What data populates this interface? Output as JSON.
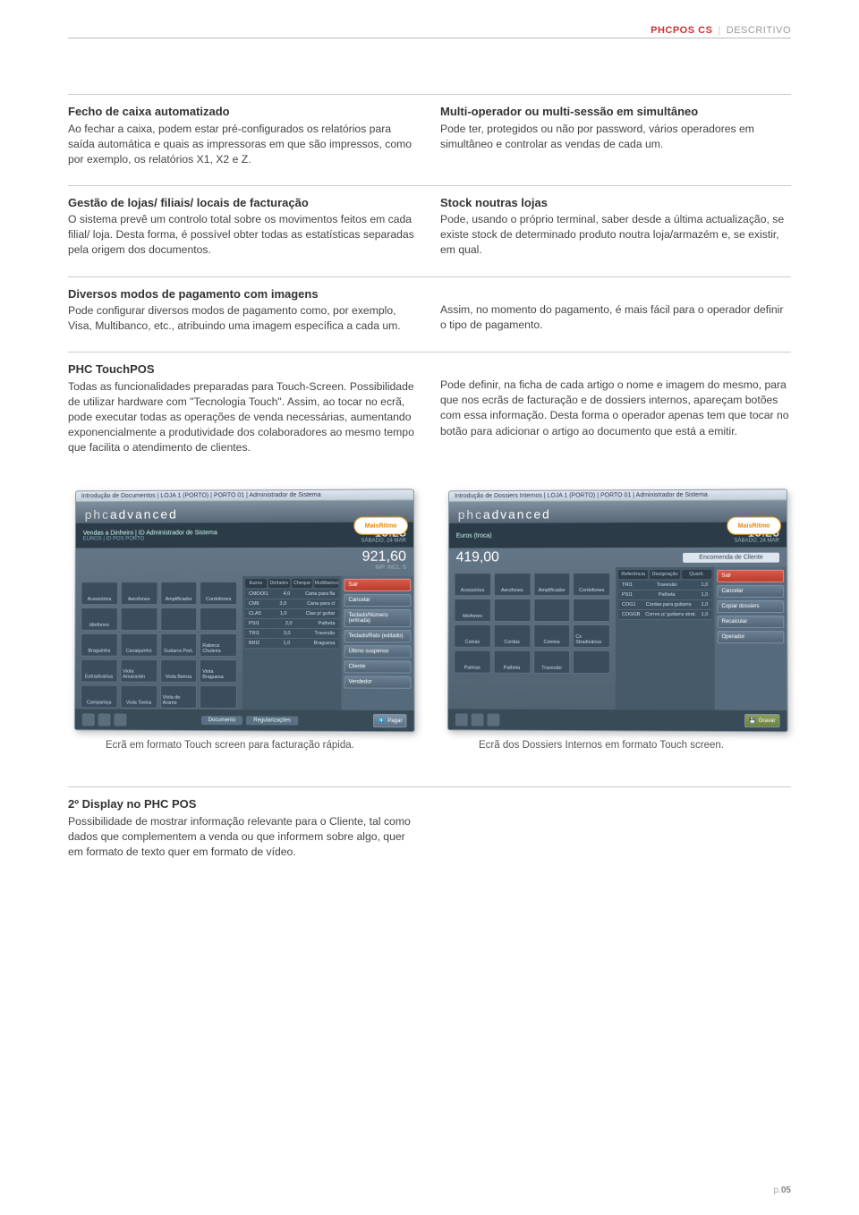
{
  "header": {
    "product": "PHCPOS CS",
    "section": "DESCRITIVO"
  },
  "blocks": [
    {
      "left": {
        "title": "Fecho de caixa automatizado",
        "body": "Ao fechar a caixa, podem estar pré-configurados os relatórios para saída automática e quais as impressoras em que são impressos, como por exemplo, os relatórios X1, X2 e Z."
      },
      "right": {
        "title": "Multi-operador ou multi-sessão em simultâneo",
        "body": "Pode ter, protegidos ou não por password, vários operadores em simultâneo e controlar as vendas de cada um."
      }
    },
    {
      "left": {
        "title": "Gestão de lojas/ filiais/ locais de facturação",
        "body": "O sistema prevê um controlo total sobre os movimentos feitos em cada filial/ loja. Desta forma, é possível obter todas as estatísticas separadas pela origem dos documentos."
      },
      "right": {
        "title": "Stock noutras lojas",
        "body": "Pode, usando o próprio terminal, saber desde a última actualização, se existe stock de determinado produto noutra loja/armazém e, se existir, em qual."
      }
    },
    {
      "left": {
        "title": "Diversos modos de pagamento com imagens",
        "body": "Pode configurar diversos modos de pagamento como, por exemplo, Visa, Multibanco, etc., atribuindo uma imagem específica a cada um."
      },
      "right": {
        "title": "",
        "body": "Assim, no momento do pagamento, é mais fácil para o operador definir o tipo de pagamento."
      }
    },
    {
      "left": {
        "title": "PHC TouchPOS",
        "body": "Todas as funcionalidades preparadas para Touch-Screen. Possibilidade de utilizar hardware com \"Tecnologia Touch\". Assim, ao tocar no ecrã, pode executar todas as operações de venda necessárias, aumentando exponencialmente a produtividade dos colaboradores ao mesmo tempo que facilita o atendimento de clientes."
      },
      "right": {
        "title": "",
        "body": "Pode definir, na ficha de cada artigo o nome e imagem do mesmo, para que nos ecrãs de facturação e de dossiers internos, apareçam botões com essa informação. Desta forma o operador apenas tem que tocar no botão para adicionar o artigo ao documento que está a emitir."
      }
    }
  ],
  "screenshots": {
    "left": {
      "titlebar": "Introdução de Documentos | LOJA 1 (PORTO) | PORTO 01 | Administrador de Sistema",
      "logo": "phcadvanced",
      "barTitle": "Vendas a Dinheiro | ID Administrador de Sistema",
      "barSub": "EUROS | ID POS PORTO",
      "time": "19:23",
      "day": "SÁBADO, 24 MAR",
      "total": "921,60",
      "totalSub": "IMP. INCL. S",
      "tabs": [
        "Euros",
        "Dinheiro",
        "Cheque",
        "Multibanco"
      ],
      "list": [
        [
          "CMOOI1",
          "4,0",
          "Cana para fla"
        ],
        [
          "CM6",
          "3,0",
          "Cana para cl"
        ],
        [
          "CLA5",
          "1,0",
          "Clas p/ guitar"
        ],
        [
          "PSI1",
          "2,0",
          "Palheta"
        ],
        [
          "TRI1",
          "3,0",
          "Travesão"
        ],
        [
          "BRI2",
          "1,0",
          "Braguesa"
        ]
      ],
      "gridItems": [
        "Acessórios",
        "Aerofones",
        "Amplificador",
        "Cordofones",
        "Idiofones",
        "",
        "",
        "",
        "Braguinha",
        "Cavaquinho",
        "Guitarra Port.",
        "Rabeca Chuleira",
        "Estradivárius",
        "Viola Amarantin",
        "Viola Beiroa",
        "Viola Braguesa",
        "Campaniça",
        "Viola Toeira",
        "Viola de Arame",
        ""
      ],
      "rightButtons": [
        "Sair",
        "Cancelar",
        "Teclado/Número (entrada)",
        "Teclado/Rato (editado)",
        "Último suspenso",
        "Cliente",
        "Vendedor"
      ],
      "footTabs": [
        "Documento",
        "Regularizações"
      ],
      "pagar": "Pagar",
      "mais": "MaisRitmo",
      "caption": "Ecrã em formato Touch screen para facturação rápida."
    },
    "right": {
      "titlebar": "Introdução de Dossiers Internos | LOJA 1 (PORTO) | PORTO 01 | Administrador de Sistema",
      "logo": "phcadvanced",
      "barTitle": "Euros (troca)",
      "time": "19:26",
      "day": "SÁBADO, 24 MAR",
      "total": "419,00",
      "encomenda": "Encomenda de Cliente",
      "tabs": [
        "Referência",
        "Designação",
        "Quant."
      ],
      "list": [
        [
          "TRI1",
          "Travesão",
          "1,0"
        ],
        [
          "PSI1",
          "Palheta",
          "1,0"
        ],
        [
          "COG1",
          "Cordas para guitarra",
          "1,0"
        ],
        [
          "COGGB",
          "Corres p/ guitarra strat.",
          "1,0"
        ]
      ],
      "gridItems": [
        "Acessórios",
        "Aerofones",
        "Amplificador",
        "Cordofones",
        "Idiofones",
        "",
        "",
        "",
        "Caixas",
        "Cordas",
        "Correia",
        "Cx Stradivárius",
        "Palmas",
        "Palheta",
        "Travesão",
        ""
      ],
      "rightButtons": [
        "Sair",
        "Cancelar",
        "Copiar dossiers",
        "Recalcular",
        "Operador"
      ],
      "gravar": "Gravar",
      "mais": "MaisRitmo",
      "caption": "Ecrã dos Dossiers Internos em formato Touch screen."
    }
  },
  "bottom": {
    "title": "2º Display no PHC POS",
    "body": "Possibilidade de mostrar informação relevante para o Cliente, tal como dados que complementem a venda ou que informem sobre algo, quer em formato de texto quer em formato de vídeo."
  },
  "page": {
    "prefix": "p.",
    "num": "05"
  }
}
